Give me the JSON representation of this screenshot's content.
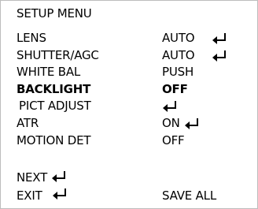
{
  "title": "SETUP MENU",
  "items": [
    {
      "label": "LENS",
      "value": "AUTO",
      "has_enter": true
    },
    {
      "label": "SHUTTER/AGC",
      "value": "AUTO",
      "has_enter": true
    },
    {
      "label": "WHITE BAL",
      "value": "PUSH",
      "has_enter": false
    },
    {
      "label": "BACKLIGHT",
      "value": "OFF",
      "has_enter": false,
      "highlighted": true
    },
    {
      "label": "PICT ADJUST",
      "value": "",
      "has_enter": true
    },
    {
      "label": "ATR",
      "value": "ON",
      "has_enter": true
    },
    {
      "label": "MOTION DET",
      "value": "OFF",
      "has_enter": false
    }
  ],
  "footer": {
    "next_label": "NEXT",
    "exit_label": "EXIT",
    "save_all_label": "SAVE ALL"
  },
  "icon": "enter-return-icon"
}
